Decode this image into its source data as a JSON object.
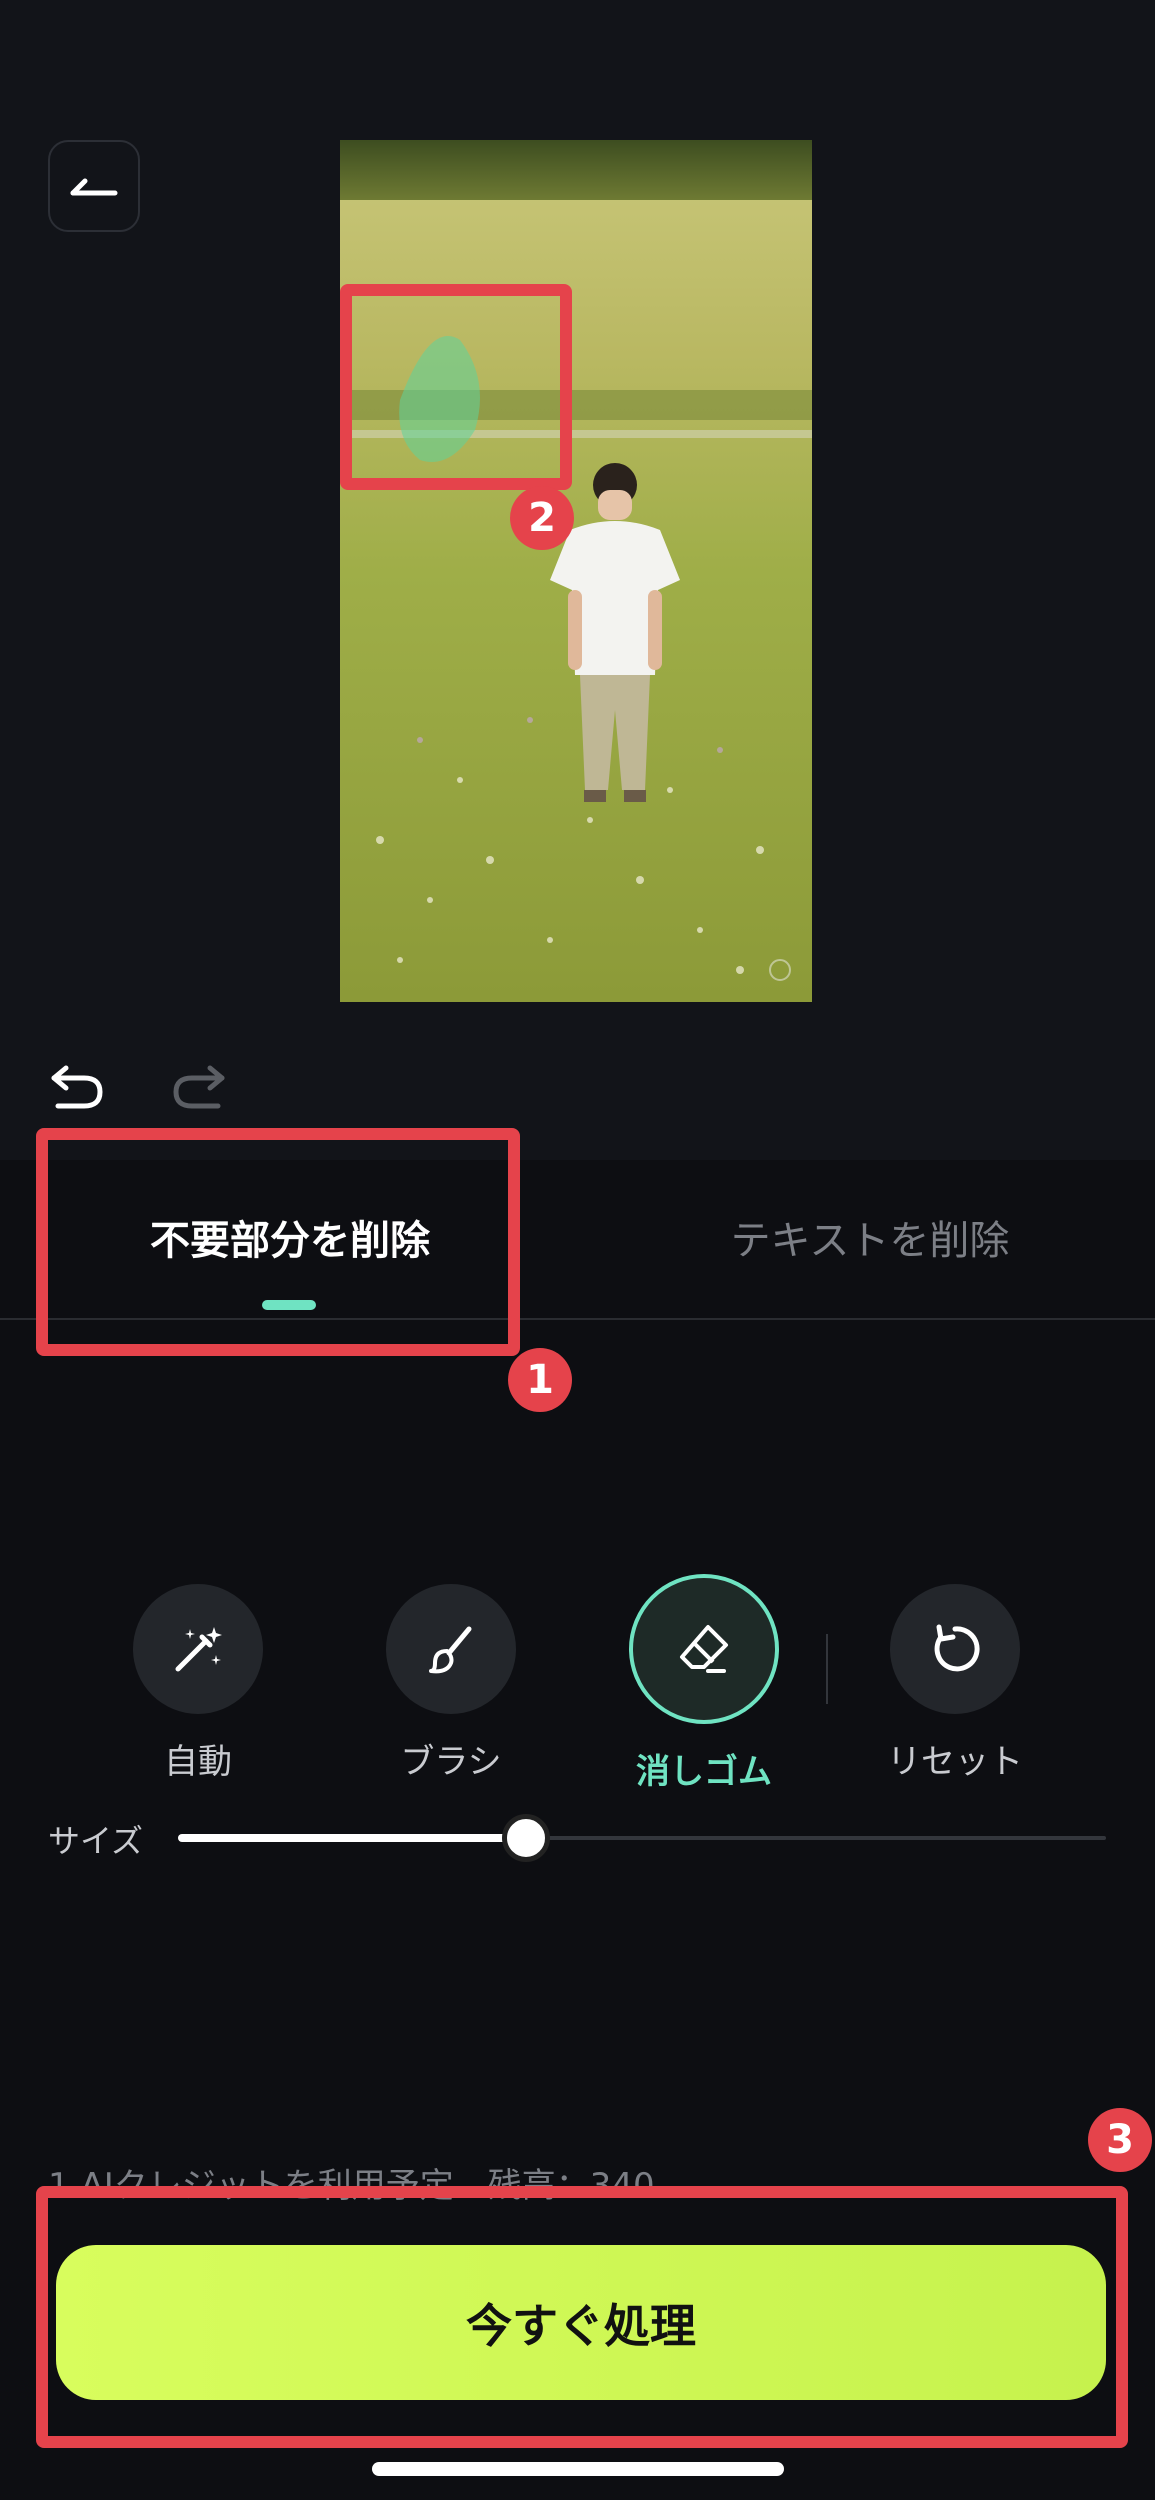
{
  "header": {
    "back_icon": "back-arrow-icon"
  },
  "preview": {
    "description_icon": "watermark-icon"
  },
  "history": {
    "undo_icon": "undo-icon",
    "redo_icon": "redo-icon"
  },
  "tabs": [
    {
      "label": "不要部分を削除",
      "active": true
    },
    {
      "label": "テキストを削除",
      "active": false
    }
  ],
  "tools": [
    {
      "label": "自動",
      "icon": "magic-wand-icon",
      "active": false
    },
    {
      "label": "ブラシ",
      "icon": "brush-icon",
      "active": false
    },
    {
      "label": "消しゴム",
      "icon": "eraser-icon",
      "active": true
    },
    {
      "label": "リセット",
      "icon": "reset-icon",
      "active": false
    }
  ],
  "size": {
    "label": "サイズ",
    "value_fraction": 0.375
  },
  "credits": {
    "text": "1 AIクレジットを利用予定　残高：340"
  },
  "process": {
    "label": "今すぐ処理"
  },
  "annotations": [
    "1",
    "2",
    "3"
  ],
  "colors": {
    "accent": "#6fe3c2",
    "cta": "#d3fa58",
    "annotation": "#e5434b"
  }
}
